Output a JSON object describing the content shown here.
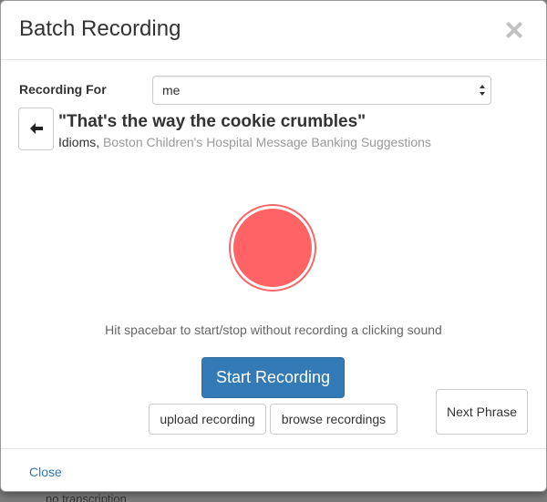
{
  "backdrop": {
    "text": "no transcription"
  },
  "modal": {
    "title": "Batch Recording",
    "close_symbol": "×",
    "recording_for": {
      "label": "Recording For",
      "selected": "me"
    },
    "phrase": {
      "text": "\"That's the way the cookie crumbles\"",
      "category": "Idioms,",
      "source": "Boston Children's Hospital Message Banking Suggestions"
    },
    "record_button": {
      "color": "#fe6465",
      "ring_color": "#f4696a"
    },
    "hint": "Hit spacebar to start/stop without recording a clicking sound",
    "start_label": "Start Recording",
    "upload_label": "upload recording",
    "browse_label": "browse recordings",
    "next_label": "Next Phrase",
    "footer_close": "Close"
  },
  "icons": {
    "back": "arrow-left-icon",
    "close": "close-icon",
    "select": "select-arrows-icon"
  },
  "colors": {
    "primary": "#337ab7",
    "link": "#337ab7",
    "muted": "#999999"
  }
}
